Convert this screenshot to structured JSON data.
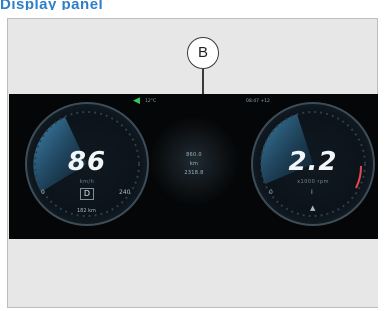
{
  "header": {
    "title": "Display panel"
  },
  "callout": {
    "label": "B"
  },
  "cluster": {
    "status_left": "12°C",
    "status_right": "08:47 +12",
    "left_gauge": {
      "value": "86",
      "unit": "km/h",
      "gear": "D",
      "left_label": "0",
      "right_label": "240",
      "bottom_label": "182 km"
    },
    "center": {
      "line1": "860.0",
      "line2": "km",
      "line3": "2318.8"
    },
    "right_gauge": {
      "value": "2.2",
      "unit": "x1000 rpm",
      "left_label": "0",
      "center_label": "I",
      "warn_icon": "▲"
    }
  },
  "colors": {
    "accent_blue": "#2e7ec8",
    "gauge_sweep": "#3aa0e0",
    "indicator_green": "#34c759"
  }
}
